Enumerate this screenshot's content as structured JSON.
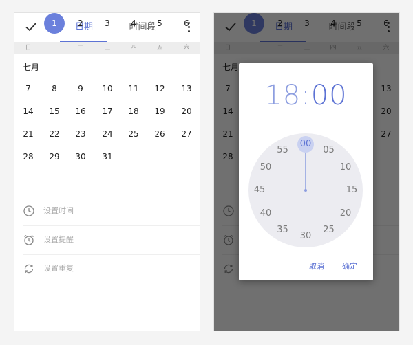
{
  "topbar": {
    "check_icon": "check-icon",
    "tabs": [
      {
        "label": "日期"
      },
      {
        "label": "时间段"
      }
    ],
    "more_icon": "more-vert-icon"
  },
  "weekdays": [
    "日",
    "一",
    "二",
    "三",
    "四",
    "五",
    "六"
  ],
  "calendar": {
    "month": "七月",
    "start_weekday": 1,
    "days_in_month": 31,
    "selected_day": 1
  },
  "options": [
    {
      "icon": "clock-icon",
      "label": "设置时间"
    },
    {
      "icon": "alarm-icon",
      "label": "设置提醒"
    },
    {
      "icon": "repeat-icon",
      "label": "设置重复"
    }
  ],
  "time_dialog": {
    "hour": "18",
    "separator": ":",
    "minute": "00",
    "dial_marks": [
      "00",
      "05",
      "10",
      "15",
      "20",
      "25",
      "30",
      "35",
      "40",
      "45",
      "50",
      "55"
    ],
    "selected_mark": "00",
    "cancel_label": "取消",
    "ok_label": "确定"
  },
  "colors": {
    "accent": "#5d73d4",
    "selected_day_bg": "#6b80dc",
    "dial_bg": "#ececf1",
    "overlay": "rgba(0,0,0,0.56)"
  }
}
